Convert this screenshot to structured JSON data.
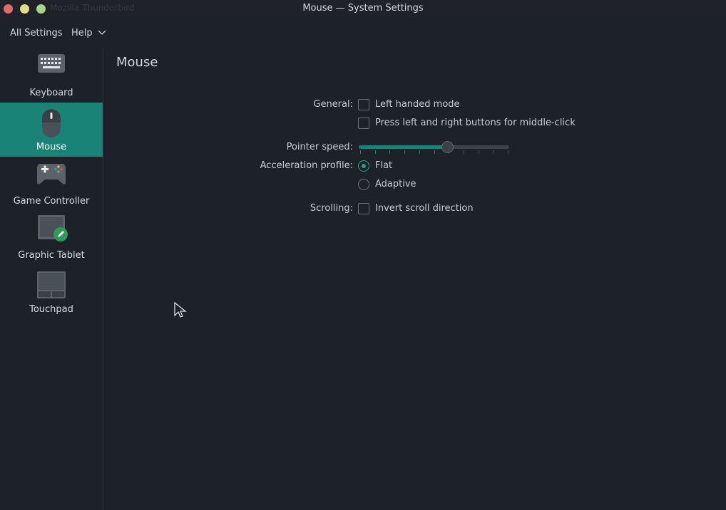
{
  "window": {
    "title": "Mouse — System Settings",
    "background_title": "Mozilla Thunderbird"
  },
  "menubar": {
    "all_settings": "All Settings",
    "help": "Help"
  },
  "sidebar": {
    "items": [
      {
        "label": "Keyboard",
        "icon": "keyboard-icon"
      },
      {
        "label": "Mouse",
        "icon": "mouse-icon",
        "active": true
      },
      {
        "label": "Game Controller",
        "icon": "gamepad-icon"
      },
      {
        "label": "Graphic Tablet",
        "icon": "tablet-icon"
      },
      {
        "label": "Touchpad",
        "icon": "touchpad-icon"
      }
    ]
  },
  "main": {
    "title": "Mouse",
    "general_label": "General:",
    "left_handed": {
      "label": "Left handed mode",
      "checked": false
    },
    "middle_click": {
      "label": "Press left and right buttons for middle-click",
      "checked": false
    },
    "pointer_speed_label": "Pointer speed:",
    "pointer_speed": {
      "value_fraction": 0.59,
      "ticks": 11
    },
    "accel_label": "Acceleration profile:",
    "accel_options": [
      {
        "label": "Flat",
        "checked": true
      },
      {
        "label": "Adaptive",
        "checked": false
      }
    ],
    "scrolling_label": "Scrolling:",
    "invert_scroll": {
      "label": "Invert scroll direction",
      "checked": false
    }
  },
  "colors": {
    "accent": "#1a8377",
    "background": "#1d2228",
    "text": "#c9ccd0"
  }
}
